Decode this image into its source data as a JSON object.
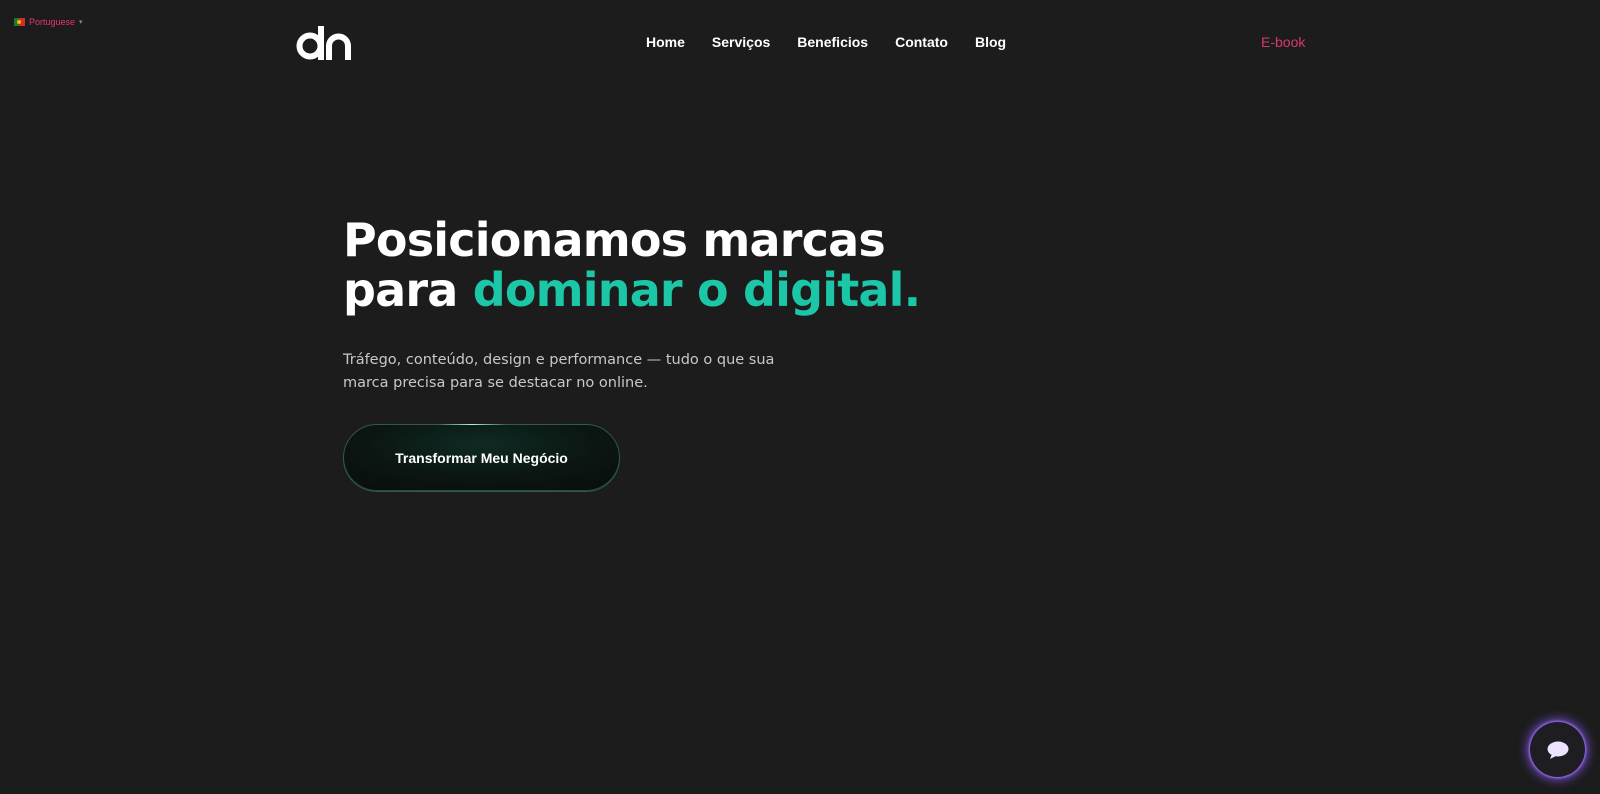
{
  "language_selector": {
    "label": "Portuguese",
    "caret": "▾",
    "flag_icon": "portugal-flag-icon"
  },
  "brand": {
    "logo_text": "dn",
    "logo_color": "#ffffff"
  },
  "nav": {
    "items": [
      {
        "label": "Home"
      },
      {
        "label": "Serviços"
      },
      {
        "label": "Beneficios"
      },
      {
        "label": "Contato"
      },
      {
        "label": "Blog"
      }
    ],
    "ebook_label": "E-book"
  },
  "hero": {
    "headline_line1": "Posicionamos marcas",
    "headline_line2_prefix": "para ",
    "headline_line2_accent": "dominar o digital.",
    "subtitle": "Tráfego, conteúdo, design e performance — tudo o que sua marca precisa para se destacar no online.",
    "cta_label": "Transformar Meu Negócio"
  },
  "chat_widget": {
    "icon": "chat-bubble-icon"
  },
  "colors": {
    "background": "#1c1c1c",
    "accent_teal": "#1cc7a8",
    "accent_pink": "#d63a6e",
    "chat_glow": "#8c5aff"
  }
}
